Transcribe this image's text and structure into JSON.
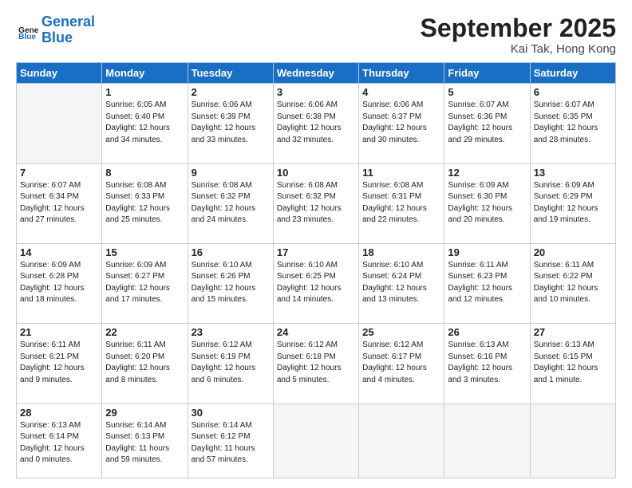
{
  "header": {
    "logo_general": "General",
    "logo_blue": "Blue",
    "month_title": "September 2025",
    "subtitle": "Kai Tak, Hong Kong"
  },
  "weekdays": [
    "Sunday",
    "Monday",
    "Tuesday",
    "Wednesday",
    "Thursday",
    "Friday",
    "Saturday"
  ],
  "weeks": [
    [
      {
        "day": "",
        "content": ""
      },
      {
        "day": "1",
        "content": "Sunrise: 6:05 AM\nSunset: 6:40 PM\nDaylight: 12 hours\nand 34 minutes."
      },
      {
        "day": "2",
        "content": "Sunrise: 6:06 AM\nSunset: 6:39 PM\nDaylight: 12 hours\nand 33 minutes."
      },
      {
        "day": "3",
        "content": "Sunrise: 6:06 AM\nSunset: 6:38 PM\nDaylight: 12 hours\nand 32 minutes."
      },
      {
        "day": "4",
        "content": "Sunrise: 6:06 AM\nSunset: 6:37 PM\nDaylight: 12 hours\nand 30 minutes."
      },
      {
        "day": "5",
        "content": "Sunrise: 6:07 AM\nSunset: 6:36 PM\nDaylight: 12 hours\nand 29 minutes."
      },
      {
        "day": "6",
        "content": "Sunrise: 6:07 AM\nSunset: 6:35 PM\nDaylight: 12 hours\nand 28 minutes."
      }
    ],
    [
      {
        "day": "7",
        "content": "Sunrise: 6:07 AM\nSunset: 6:34 PM\nDaylight: 12 hours\nand 27 minutes."
      },
      {
        "day": "8",
        "content": "Sunrise: 6:08 AM\nSunset: 6:33 PM\nDaylight: 12 hours\nand 25 minutes."
      },
      {
        "day": "9",
        "content": "Sunrise: 6:08 AM\nSunset: 6:32 PM\nDaylight: 12 hours\nand 24 minutes."
      },
      {
        "day": "10",
        "content": "Sunrise: 6:08 AM\nSunset: 6:32 PM\nDaylight: 12 hours\nand 23 minutes."
      },
      {
        "day": "11",
        "content": "Sunrise: 6:08 AM\nSunset: 6:31 PM\nDaylight: 12 hours\nand 22 minutes."
      },
      {
        "day": "12",
        "content": "Sunrise: 6:09 AM\nSunset: 6:30 PM\nDaylight: 12 hours\nand 20 minutes."
      },
      {
        "day": "13",
        "content": "Sunrise: 6:09 AM\nSunset: 6:29 PM\nDaylight: 12 hours\nand 19 minutes."
      }
    ],
    [
      {
        "day": "14",
        "content": "Sunrise: 6:09 AM\nSunset: 6:28 PM\nDaylight: 12 hours\nand 18 minutes."
      },
      {
        "day": "15",
        "content": "Sunrise: 6:09 AM\nSunset: 6:27 PM\nDaylight: 12 hours\nand 17 minutes."
      },
      {
        "day": "16",
        "content": "Sunrise: 6:10 AM\nSunset: 6:26 PM\nDaylight: 12 hours\nand 15 minutes."
      },
      {
        "day": "17",
        "content": "Sunrise: 6:10 AM\nSunset: 6:25 PM\nDaylight: 12 hours\nand 14 minutes."
      },
      {
        "day": "18",
        "content": "Sunrise: 6:10 AM\nSunset: 6:24 PM\nDaylight: 12 hours\nand 13 minutes."
      },
      {
        "day": "19",
        "content": "Sunrise: 6:11 AM\nSunset: 6:23 PM\nDaylight: 12 hours\nand 12 minutes."
      },
      {
        "day": "20",
        "content": "Sunrise: 6:11 AM\nSunset: 6:22 PM\nDaylight: 12 hours\nand 10 minutes."
      }
    ],
    [
      {
        "day": "21",
        "content": "Sunrise: 6:11 AM\nSunset: 6:21 PM\nDaylight: 12 hours\nand 9 minutes."
      },
      {
        "day": "22",
        "content": "Sunrise: 6:11 AM\nSunset: 6:20 PM\nDaylight: 12 hours\nand 8 minutes."
      },
      {
        "day": "23",
        "content": "Sunrise: 6:12 AM\nSunset: 6:19 PM\nDaylight: 12 hours\nand 6 minutes."
      },
      {
        "day": "24",
        "content": "Sunrise: 6:12 AM\nSunset: 6:18 PM\nDaylight: 12 hours\nand 5 minutes."
      },
      {
        "day": "25",
        "content": "Sunrise: 6:12 AM\nSunset: 6:17 PM\nDaylight: 12 hours\nand 4 minutes."
      },
      {
        "day": "26",
        "content": "Sunrise: 6:13 AM\nSunset: 6:16 PM\nDaylight: 12 hours\nand 3 minutes."
      },
      {
        "day": "27",
        "content": "Sunrise: 6:13 AM\nSunset: 6:15 PM\nDaylight: 12 hours\nand 1 minute."
      }
    ],
    [
      {
        "day": "28",
        "content": "Sunrise: 6:13 AM\nSunset: 6:14 PM\nDaylight: 12 hours\nand 0 minutes."
      },
      {
        "day": "29",
        "content": "Sunrise: 6:14 AM\nSunset: 6:13 PM\nDaylight: 11 hours\nand 59 minutes."
      },
      {
        "day": "30",
        "content": "Sunrise: 6:14 AM\nSunset: 6:12 PM\nDaylight: 11 hours\nand 57 minutes."
      },
      {
        "day": "",
        "content": ""
      },
      {
        "day": "",
        "content": ""
      },
      {
        "day": "",
        "content": ""
      },
      {
        "day": "",
        "content": ""
      }
    ]
  ]
}
